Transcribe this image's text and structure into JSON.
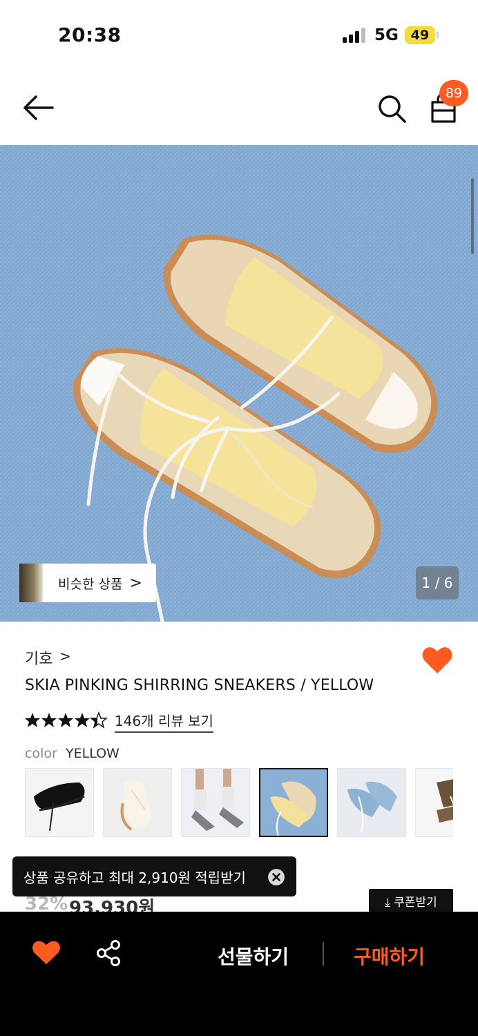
{
  "status_bar": {
    "time": "20:38",
    "network": "5G",
    "battery": "49"
  },
  "header": {
    "cart_count": "89"
  },
  "gallery": {
    "similar_label": "비슷한 상품",
    "similar_arrow": ">",
    "page_indicator": "1 / 6"
  },
  "product": {
    "brand": "기호",
    "brand_arrow": ">",
    "title": "SKIA PINKING SHIRRING SNEAKERS / YELLOW",
    "rating": 4.5,
    "review_link": "146개 리뷰 보기",
    "color_label": "color",
    "color_value": "YELLOW",
    "swatches": [
      "black",
      "cream",
      "grey",
      "yellow",
      "blue",
      "brown"
    ],
    "selected_swatch": "yellow"
  },
  "toast": {
    "text": "상품 공유하고 최대 2,910원 적립받기"
  },
  "price": {
    "discount": "32%",
    "price": "93,930원",
    "coupon_label": "⤓ 쿠폰받기"
  },
  "bottom_bar": {
    "gift_label": "선물하기",
    "buy_label": "구매하기"
  },
  "colors": {
    "accent": "#ff5a1f",
    "bar": "#000000"
  }
}
